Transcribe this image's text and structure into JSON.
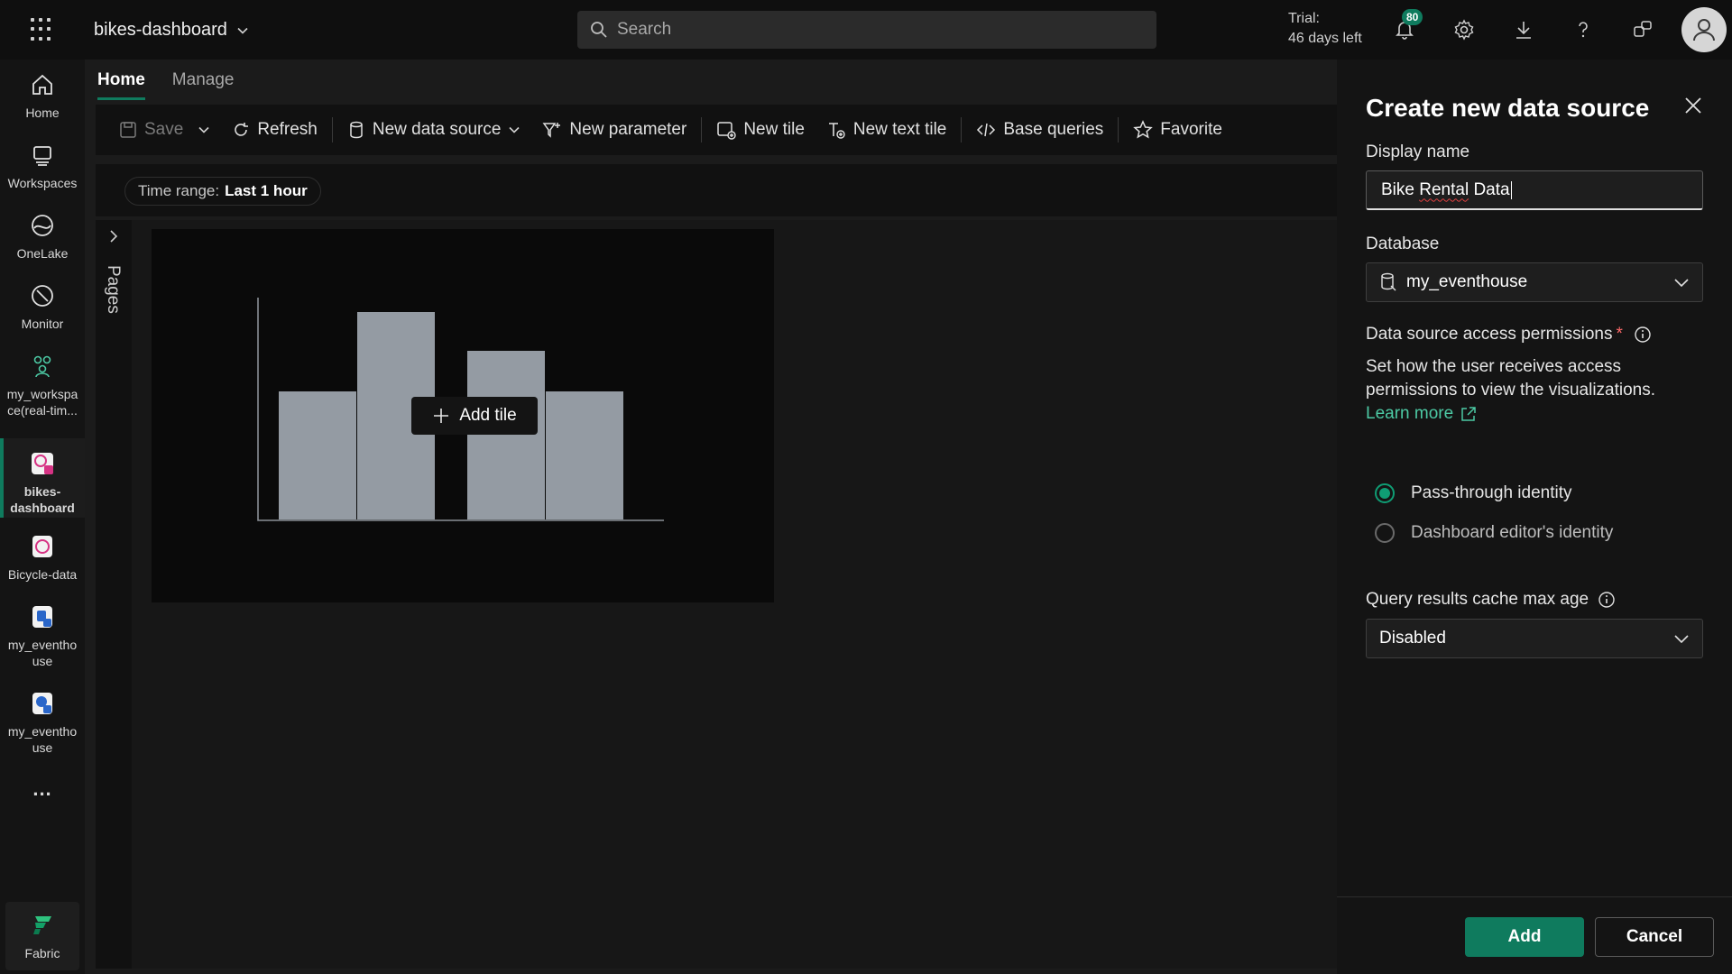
{
  "app": {
    "title": "bikes-dashboard",
    "search_placeholder": "Search",
    "trial_line1": "Trial:",
    "trial_line2": "46 days left",
    "notification_count": "80"
  },
  "leftnav": {
    "items": [
      {
        "label": "Home"
      },
      {
        "label": "Workspaces"
      },
      {
        "label": "OneLake"
      },
      {
        "label": "Monitor"
      },
      {
        "label_line1": "my_workspa",
        "label_line2": "ce(real-tim..."
      },
      {
        "label_line1": "bikes-",
        "label_line2": "dashboard"
      },
      {
        "label": "Bicycle-data"
      },
      {
        "label_line1": "my_eventho",
        "label_line2": "use"
      },
      {
        "label_line1": "my_eventho",
        "label_line2": "use"
      }
    ],
    "more": "...",
    "fabric": "Fabric"
  },
  "tabs": [
    {
      "label": "Home"
    },
    {
      "label": "Manage"
    }
  ],
  "toolbar": {
    "save": "Save",
    "refresh": "Refresh",
    "new_data_source": "New data source",
    "new_parameter": "New parameter",
    "new_tile": "New tile",
    "new_text_tile": "New text tile",
    "base_queries": "Base queries",
    "favorite": "Favorite"
  },
  "timerange": {
    "prefix": "Time range:",
    "value": "Last 1 hour"
  },
  "pages_label": "Pages",
  "add_tile": "Add tile",
  "panel": {
    "title": "Create new data source",
    "display_name_label": "Display name",
    "display_name_word1": "Bike",
    "display_name_word2": "Rental",
    "display_name_word3": "Data",
    "database_label": "Database",
    "database_value": "my_eventhouse",
    "permissions_label": "Data source access permissions",
    "required_mark": "*",
    "permissions_desc": "Set how the user receives access permissions to view the visualizations.",
    "learn_more": "Learn more",
    "radio_passthrough": "Pass-through identity",
    "radio_editor": "Dashboard editor's identity",
    "cache_label": "Query results cache max age",
    "cache_value": "Disabled",
    "add_button": "Add",
    "cancel_button": "Cancel"
  },
  "colors": {
    "accent": "#0f7b5e",
    "link": "#4cc9a4",
    "panel_bg": "#141414"
  }
}
